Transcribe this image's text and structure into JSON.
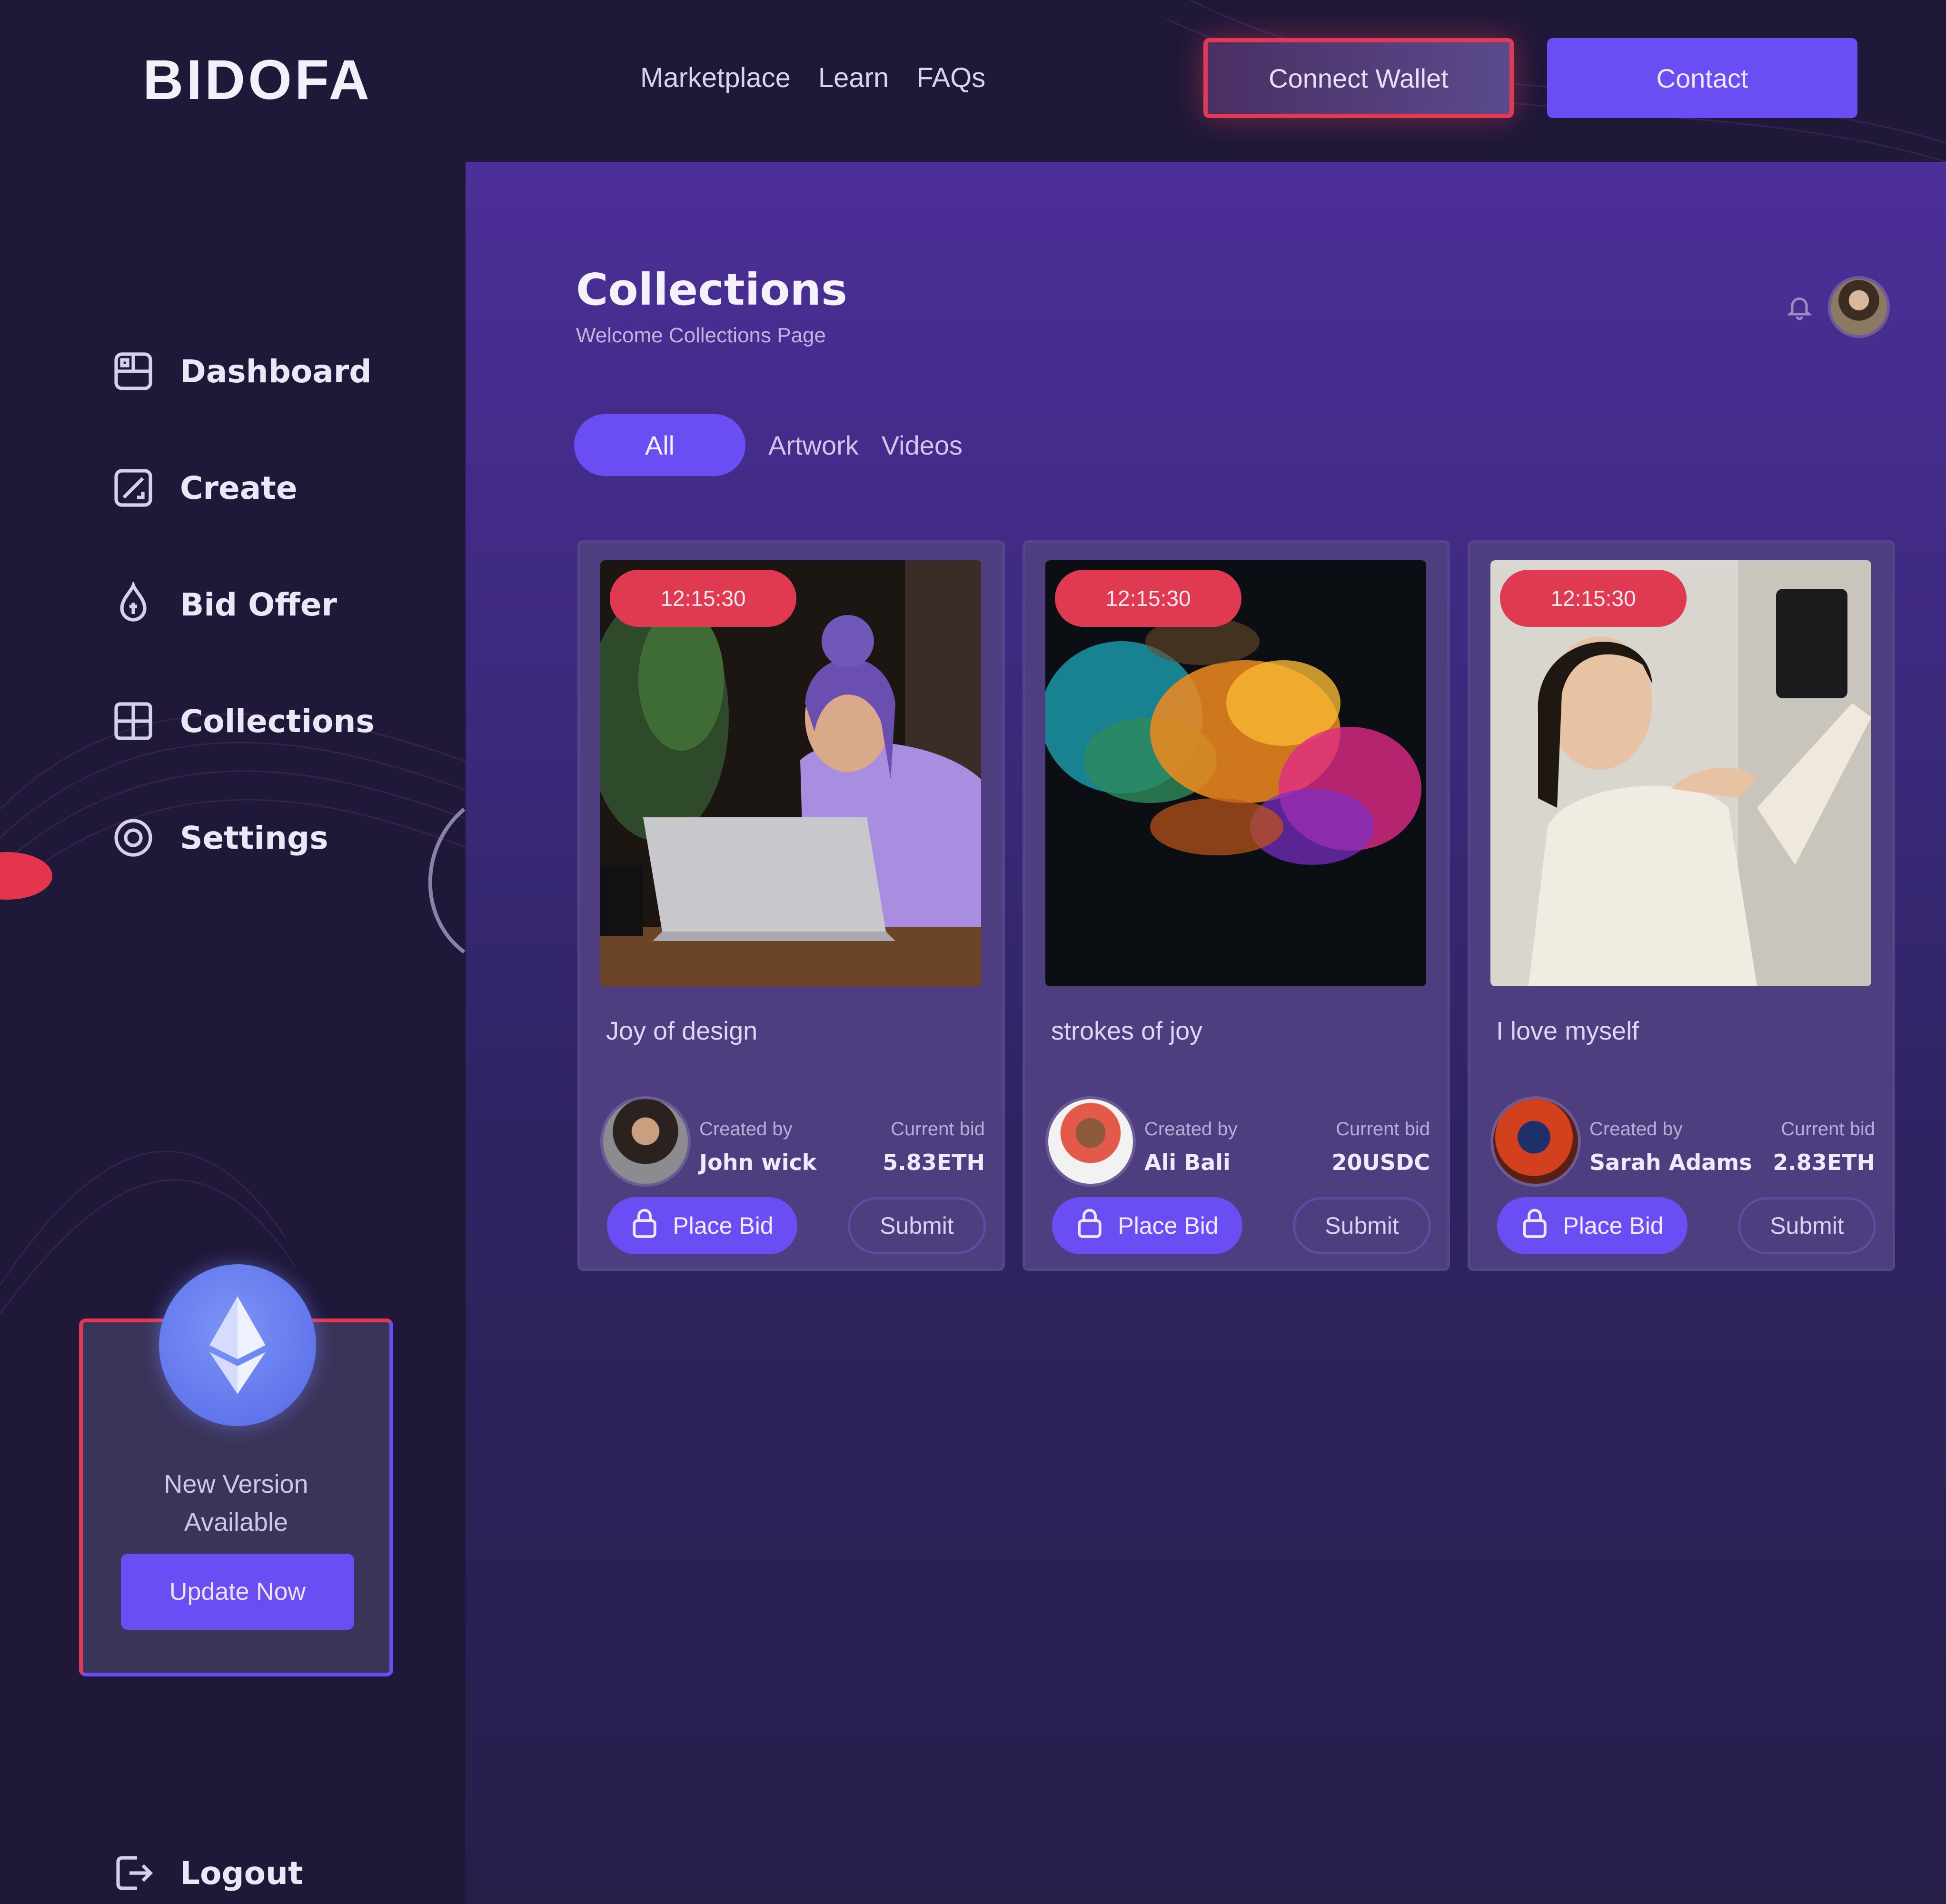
{
  "brand": {
    "logo": "BIDOFA"
  },
  "topnav": {
    "items": [
      "Marketplace",
      "Learn",
      "FAQs"
    ]
  },
  "header": {
    "connect_wallet": "Connect Wallet",
    "contact": "Contact"
  },
  "sidebar": {
    "items": [
      {
        "label": "Dashboard",
        "icon": "dashboard-icon"
      },
      {
        "label": "Create",
        "icon": "create-icon"
      },
      {
        "label": "Bid Offer",
        "icon": "bid-offer-icon"
      },
      {
        "label": "Collections",
        "icon": "collections-icon",
        "active": true
      },
      {
        "label": "Settings",
        "icon": "settings-icon"
      }
    ],
    "update_card": {
      "line1": "New Version",
      "line2": "Available",
      "button": "Update Now",
      "icon": "ethereum-icon"
    },
    "logout": "Logout"
  },
  "main": {
    "title": "Collections",
    "subtitle": "Welcome Collections Page",
    "tabs": [
      "All",
      "Artwork",
      "Videos"
    ],
    "active_tab": "All"
  },
  "cards": [
    {
      "timer": "12:15:30",
      "title": "Joy of design",
      "created_by_label": "Created by",
      "creator": "John wick",
      "current_bid_label": "Current bid",
      "current_bid": "5.83ETH",
      "place_bid": "Place Bid",
      "submit": "Submit"
    },
    {
      "timer": "12:15:30",
      "title": "strokes of joy",
      "created_by_label": "Created by",
      "creator": "Ali Bali",
      "current_bid_label": "Current bid",
      "current_bid": "20USDC",
      "place_bid": "Place Bid",
      "submit": "Submit"
    },
    {
      "timer": "12:15:30",
      "title": "I love myself",
      "created_by_label": "Created by",
      "creator": "Sarah Adams",
      "current_bid_label": "Current bid",
      "current_bid": "2.83ETH",
      "place_bid": "Place Bid",
      "submit": "Submit"
    }
  ],
  "colors": {
    "accent": "#6a4ef4",
    "danger": "#e03a52",
    "background": "#1f1838",
    "panel": "#3e2a80"
  }
}
